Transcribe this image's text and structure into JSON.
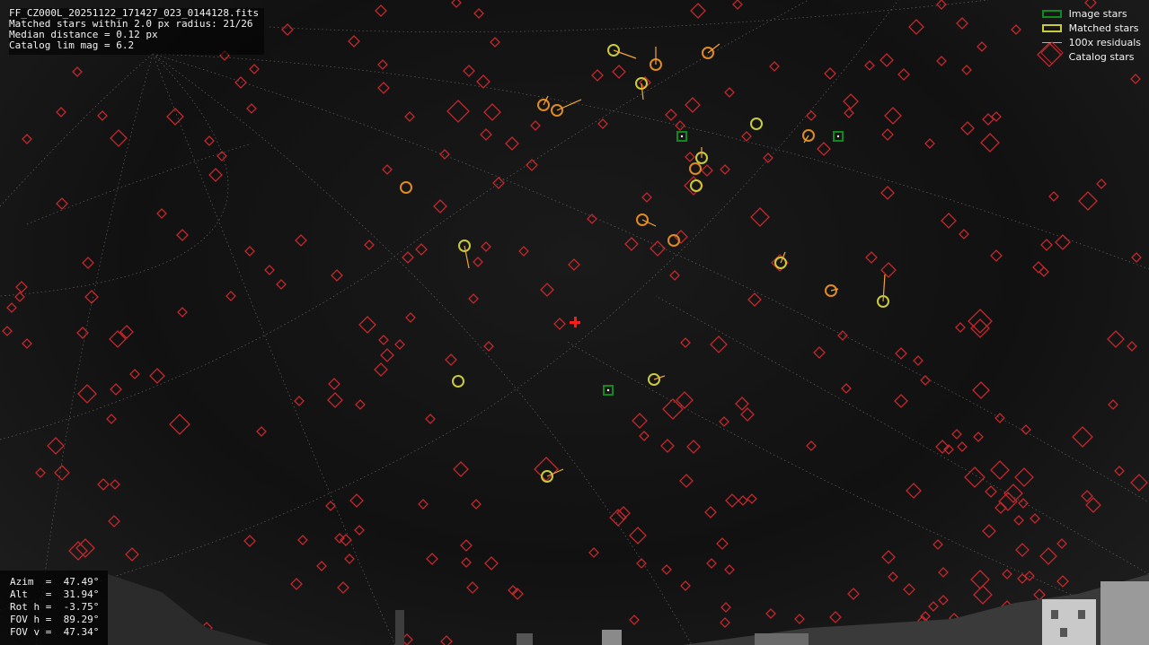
{
  "header": {
    "filename": "FF_CZ000L_20251122_171427_023_0144128.fits",
    "matched_line": "Matched stars within 2.0 px radius: 21/26",
    "median_line": "Median distance = 0.12 px",
    "limmag_line": "Catalog lim mag = 6.2"
  },
  "pointing": {
    "azim": "Azim  =  47.49°",
    "alt": "Alt   =  31.94°",
    "rot": "Rot h =  -3.75°",
    "fov_h": "FOV h =  89.29°",
    "fov_v": "FOV v =  47.34°"
  },
  "legend": {
    "image_stars": "Image stars",
    "matched_stars": "Matched stars",
    "residuals": "100x residuals",
    "catalog_stars": "Catalog stars"
  },
  "colors": {
    "catalog": "#c3282c",
    "matched_yellow": "#c8cc3a",
    "matched_orange": "#e08a22",
    "image_green": "#0f8a1e",
    "residual": "#f2a53a",
    "grid": "#7a7a7a",
    "center_marker": "#ff1a1a"
  },
  "counts": {
    "matched": 21,
    "total": 26
  }
}
